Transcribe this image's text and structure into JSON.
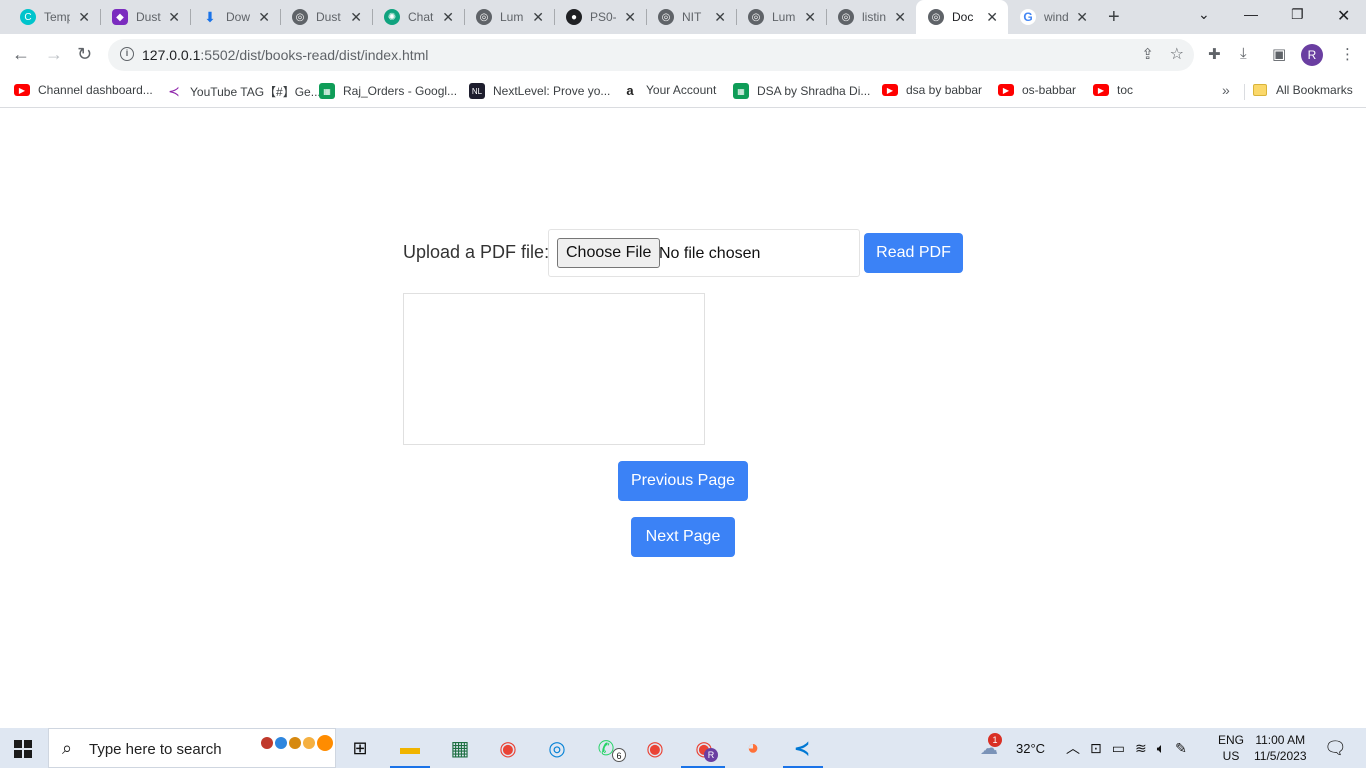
{
  "browser": {
    "tabs": [
      {
        "title": "Temp",
        "icon": "canva-icon",
        "color": "#00c4cc",
        "active": false
      },
      {
        "title": "Dust",
        "icon": "app-icon",
        "color": "#7b2cbf",
        "active": false
      },
      {
        "title": "Dow",
        "icon": "download-icon",
        "color": "#1a73e8",
        "active": false
      },
      {
        "title": "Dust",
        "icon": "globe-icon",
        "color": "#5f6368",
        "active": false
      },
      {
        "title": "Chat",
        "icon": "chatgpt-icon",
        "color": "#10a37f",
        "active": false
      },
      {
        "title": "Lum",
        "icon": "globe-icon",
        "color": "#5f6368",
        "active": false
      },
      {
        "title": "PS0-",
        "icon": "github-icon",
        "color": "#202124",
        "active": false
      },
      {
        "title": "NIT",
        "icon": "globe-icon",
        "color": "#5f6368",
        "active": false
      },
      {
        "title": "Lum",
        "icon": "globe-icon",
        "color": "#5f6368",
        "active": false
      },
      {
        "title": "listin",
        "icon": "globe-icon",
        "color": "#5f6368",
        "active": false
      },
      {
        "title": "Doc",
        "icon": "globe-icon",
        "color": "#5f6368",
        "active": true
      },
      {
        "title": "wind",
        "icon": "google-icon",
        "color": "#4285f4",
        "active": false
      }
    ],
    "url_host": "127.0.0.1",
    "url_path": ":5502/dist/books-read/dist/index.html",
    "profile_initial": "R"
  },
  "bookmarks": [
    {
      "label": "Channel dashboard...",
      "icon": "youtube-icon",
      "color": "#ff0000"
    },
    {
      "label": "YouTube TAG【#】Ge...",
      "icon": "tag-icon",
      "color": "#8e24aa"
    },
    {
      "label": "Raj_Orders - Googl...",
      "icon": "sheets-icon",
      "color": "#0f9d58"
    },
    {
      "label": "NextLevel: Prove yo...",
      "icon": "nl-icon",
      "color": "#1e1e2e",
      "short": "NL"
    },
    {
      "label": "Your Account",
      "icon": "amazon-icon",
      "color": "#222222",
      "short": "a"
    },
    {
      "label": "DSA by Shradha Di...",
      "icon": "sheets-icon",
      "color": "#0f9d58"
    },
    {
      "label": "dsa by babbar",
      "icon": "youtube-icon",
      "color": "#ff0000"
    },
    {
      "label": "os-babbar",
      "icon": "youtube-icon",
      "color": "#ff0000"
    },
    {
      "label": "toc",
      "icon": "youtube-icon",
      "color": "#ff0000"
    }
  ],
  "bookmarks_more": "»",
  "all_bookmarks": "All Bookmarks",
  "page": {
    "upload_label": "Upload a PDF file:",
    "choose_file": "Choose File",
    "no_file": "No file chosen",
    "read_pdf": "Read PDF",
    "previous_page": "Previous Page",
    "next_page": "Next Page",
    "accent": "#3b82f6"
  },
  "taskbar": {
    "search_placeholder": "Type here to search",
    "weather_temp": "32°C",
    "weather_badge": "1",
    "lang_top": "ENG",
    "lang_bottom": "US",
    "time": "11:00 AM",
    "date": "11/5/2023",
    "whatsapp_badge": "6",
    "chrome_profile_badge": "R"
  }
}
